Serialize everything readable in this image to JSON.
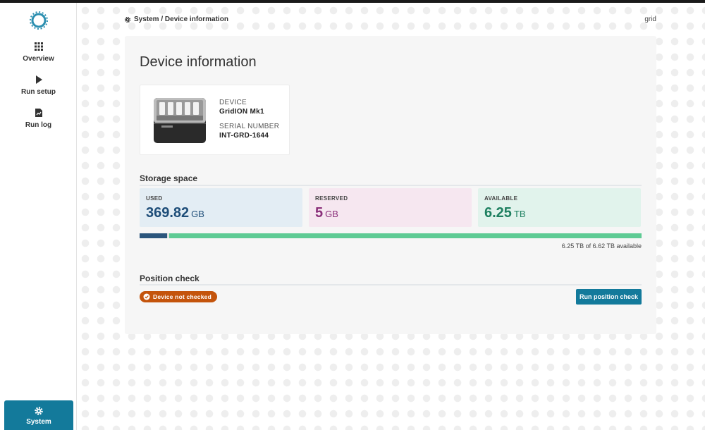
{
  "sidebar": {
    "logo": "minknow-ring-logo",
    "items": [
      {
        "label": "Overview",
        "icon": "grid-icon"
      },
      {
        "label": "Run setup",
        "icon": "play-icon"
      },
      {
        "label": "Run log",
        "icon": "document-chart-icon"
      }
    ],
    "system": {
      "label": "System",
      "icon": "gear-icon"
    }
  },
  "header": {
    "breadcrumb": "System / Device information",
    "hostname": "grid"
  },
  "main": {
    "title": "Device information",
    "device": {
      "device_label": "DEVICE",
      "device_value": "GridION Mk1",
      "serial_label": "SERIAL NUMBER",
      "serial_value": "INT-GRD-1644"
    },
    "storage": {
      "title": "Storage space",
      "used": {
        "label": "USED",
        "value": "369.82",
        "unit": "GB",
        "color": "#1f4e79"
      },
      "reserved": {
        "label": "RESERVED",
        "value": "5",
        "unit": "GB",
        "color": "#8a2f7a"
      },
      "available": {
        "label": "AVAILABLE",
        "value": "6.25",
        "unit": "TB",
        "color": "#1e8060"
      },
      "bar": {
        "used_fraction": 0.0546,
        "reserved_fraction": 0.0008,
        "available_fraction": 0.944
      },
      "summary": "6.25 TB of 6.62 TB available"
    },
    "position_check": {
      "title": "Position check",
      "status": "Device not checked",
      "button": "Run position check"
    }
  },
  "colors": {
    "accent": "#137a9b",
    "used_bg": "#e3edf4",
    "reserved_bg": "#f6e7f0",
    "available_bg": "#e1f3ec",
    "bar_used": "#2b557c",
    "bar_available": "#5ecb94",
    "badge": "#c4540c"
  }
}
